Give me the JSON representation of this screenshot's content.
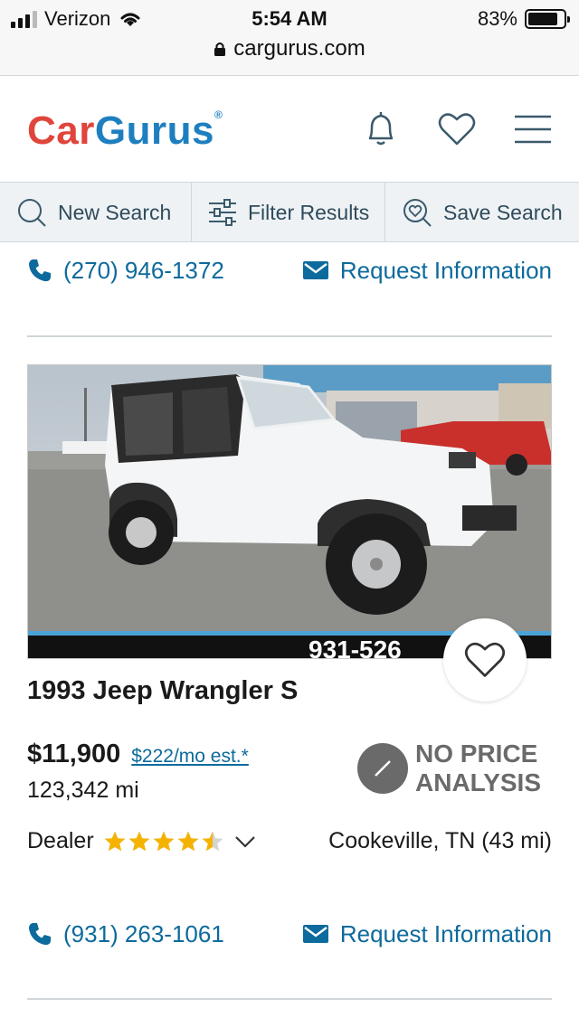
{
  "status_bar": {
    "carrier": "Verizon",
    "time": "5:54 AM",
    "battery": "83%",
    "battery_level": 0.83,
    "url": "cargurus.com"
  },
  "header": {
    "logo_car": "Car",
    "logo_gurus": "Gurus",
    "logo_mark": "®",
    "icons": [
      "bell-icon",
      "heart-icon",
      "menu-icon"
    ]
  },
  "toolbar": {
    "new_search": "New Search",
    "filter_results": "Filter Results",
    "save_search": "Save Search"
  },
  "prev_listing": {
    "phone": "(270) 946-1372",
    "request_info": "Request Information"
  },
  "listing": {
    "title": "1993 Jeep Wrangler S",
    "price": "$11,900",
    "monthly_estimate": "$222/mo est.*",
    "mileage": "123,342 mi",
    "price_analysis_line1": "NO PRICE",
    "price_analysis_line2": "ANALYSIS",
    "seller_type": "Dealer",
    "dealer_rating": 4.5,
    "location": "Cookeville, TN (43 mi)",
    "phone": "(931) 263-1061",
    "request_info": "Request Information",
    "photo_overlay_text": "931-526"
  },
  "colors": {
    "brand_red": "#e0453c",
    "brand_blue": "#1e7fc0",
    "link_blue": "#0d6a9c",
    "star_gold": "#f5b301",
    "analysis_gray": "#6a6a6a"
  }
}
